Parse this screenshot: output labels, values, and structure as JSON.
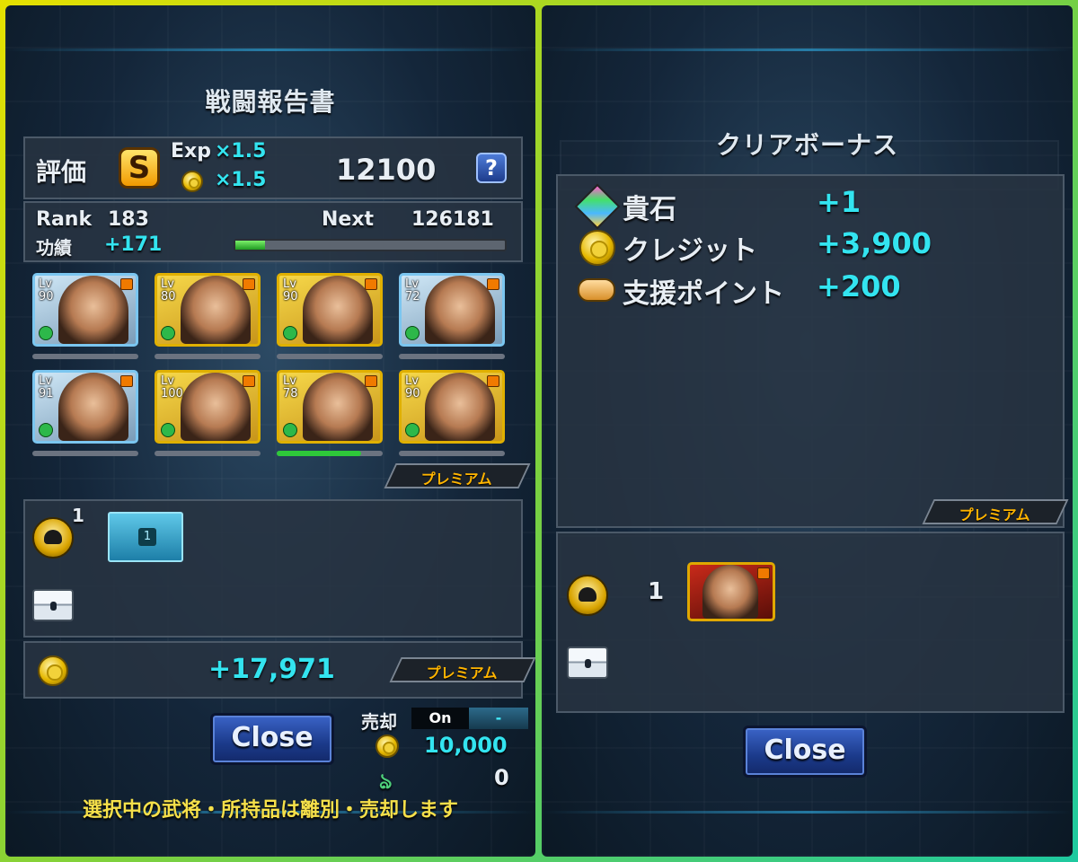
{
  "left": {
    "title": "戦闘報告書",
    "eval_label": "評価",
    "grade": "S",
    "exp_label": "Exp",
    "exp_mult": "×1.5",
    "coin_mult": "×1.5",
    "score": "12100",
    "help": "?",
    "rank_label": "Rank",
    "rank_value": "183",
    "next_label": "Next",
    "next_value": "126181",
    "merit_label": "功績",
    "merit_value": "+171",
    "exp_progress": 0.11,
    "cards": [
      {
        "lv_label": "Lv",
        "lv": "90",
        "frame": "blue",
        "hp": 0
      },
      {
        "lv_label": "Lv",
        "lv": "80",
        "frame": "gold",
        "hp": 0
      },
      {
        "lv_label": "Lv",
        "lv": "90",
        "frame": "gold",
        "hp": 0
      },
      {
        "lv_label": "Lv",
        "lv": "72",
        "frame": "blue",
        "hp": 0
      },
      {
        "lv_label": "Lv",
        "lv": "91",
        "frame": "blue",
        "hp": 0
      },
      {
        "lv_label": "Lv",
        "lv": "100",
        "frame": "gold",
        "hp": 0
      },
      {
        "lv_label": "Lv",
        "lv": "78",
        "frame": "gold",
        "hp": 0.8
      },
      {
        "lv_label": "Lv",
        "lv": "90",
        "frame": "gold",
        "hp": 0
      }
    ],
    "premium_label": "プレミアム",
    "drop_count": "1",
    "drop_item_num": "1",
    "credits": "+17,971",
    "close_label": "Close",
    "sell_label": "売却",
    "sell_toggle_on": "On",
    "sell_toggle_off": "-",
    "sell_coins": "10,000",
    "sell_other": "0",
    "warning": "選択中の武将・所持品は離別・売却します"
  },
  "right": {
    "title": "クリアボーナス",
    "rewards": [
      {
        "icon": "gem-icon",
        "name": "貴石",
        "value": "+1"
      },
      {
        "icon": "coin-icon",
        "name": "クレジット",
        "value": "+3,900"
      },
      {
        "icon": "handshake-icon",
        "name": "支援ポイント",
        "value": "+200"
      }
    ],
    "premium_label": "プレミアム",
    "drop_count": "1",
    "close_label": "Close"
  },
  "colors": {
    "accent_cyan": "#33e4f0",
    "premium_gold": "#ffb400",
    "frame_gradient": [
      "#e6e000",
      "#1ec9a0"
    ]
  }
}
